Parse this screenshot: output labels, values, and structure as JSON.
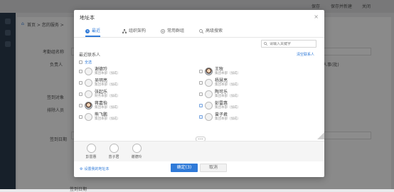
{
  "background": {
    "top_buttons": [
      "保存",
      "保存并新建",
      "关闭"
    ],
    "breadcrumb": "首页 > 您的服务 >",
    "field_labels": [
      "考勤组名称",
      "负责人",
      "签到对象",
      "排除人员",
      "签到日期"
    ],
    "right_hints": [
      "员人事(批)"
    ],
    "bottom_label": "签到日期"
  },
  "dialog": {
    "title": "地址本",
    "close": "×",
    "tabs": [
      {
        "label": "最近",
        "icon": "clock-icon",
        "active": true
      },
      {
        "label": "组织架构",
        "icon": "org-icon",
        "active": false
      },
      {
        "label": "常用群组",
        "icon": "group-icon",
        "active": false
      },
      {
        "label": "高级搜索",
        "icon": "search-icon",
        "active": false
      }
    ],
    "search_placeholder": "请输入关键字",
    "section_label": "最近联系人",
    "clear_label": "清空联系人",
    "select_all": "全选",
    "contacts_left": [
      {
        "name": "谢德玲",
        "dept": "集团本部（加成）",
        "checked": false,
        "photo": false
      },
      {
        "name": "吴明亮",
        "dept": "集团本部（加成）",
        "checked": false,
        "photo": false
      },
      {
        "name": "张起乐",
        "dept": "财务本部（加成）",
        "checked": false,
        "photo": false
      },
      {
        "name": "蒋嘉怡",
        "dept": "集团本部（加成）",
        "checked": false,
        "photo": true
      },
      {
        "name": "熊飞鹏",
        "dept": "集团本部（加成）",
        "checked": false,
        "photo": false
      }
    ],
    "contacts_right": [
      {
        "name": "王牧",
        "dept": "集团本部（加成）",
        "checked": false,
        "photo": true
      },
      {
        "name": "杨慧亮",
        "dept": "集团本部（加成）",
        "checked": false,
        "photo": false
      },
      {
        "name": "陶可乐",
        "dept": "集团本部（加成）",
        "checked": false,
        "photo": false
      },
      {
        "name": "彭雷惠",
        "dept": "集团本部（加成）",
        "checked": true,
        "photo": false
      },
      {
        "name": "曾子君",
        "dept": "集团本部（加成）",
        "checked": true,
        "photo": false
      }
    ],
    "selected": [
      "彭雷惠",
      "曾子君",
      "谢德玲"
    ],
    "footer_link": "设置我的地址本",
    "ok_label": "确定(3)",
    "cancel_label": "取消"
  },
  "colors": {
    "accent": "#2f7ad8",
    "overlay": "rgba(0,0,0,0.45)"
  }
}
